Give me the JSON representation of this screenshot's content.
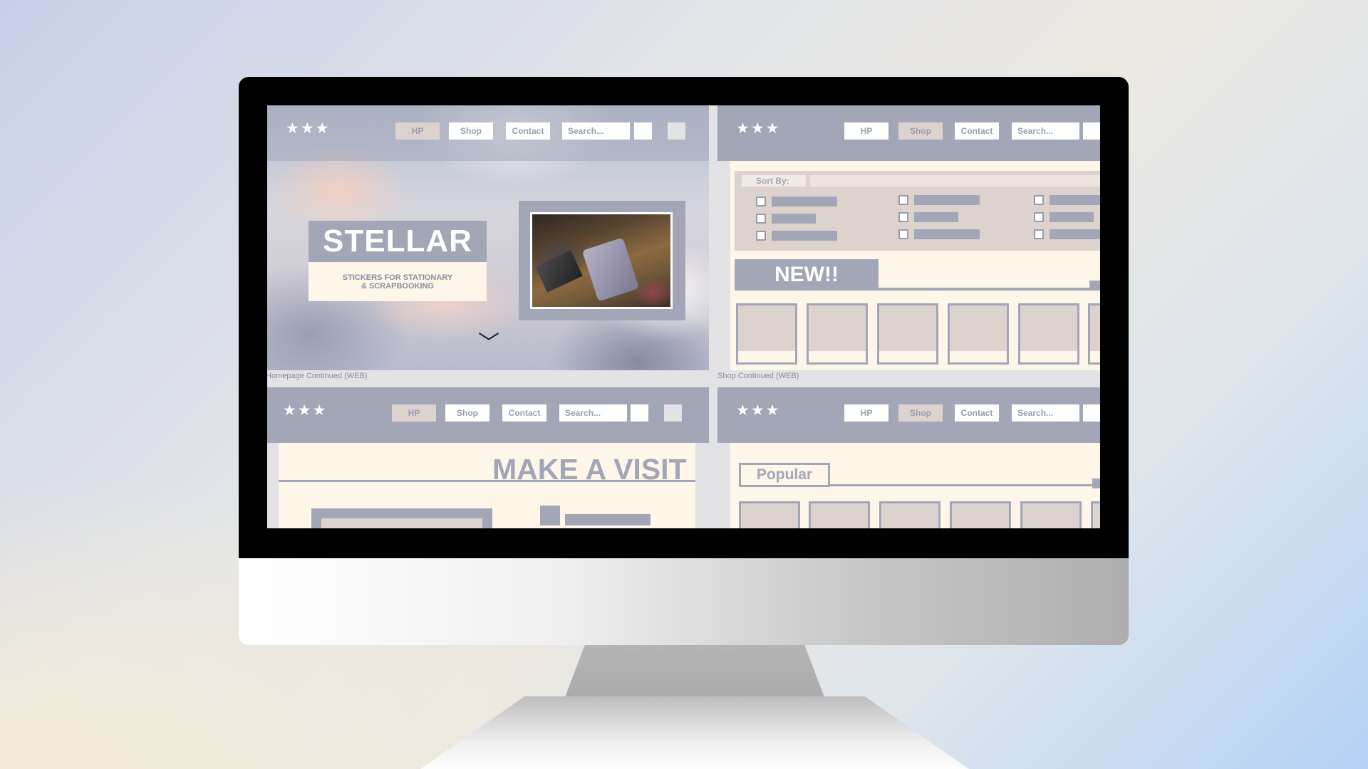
{
  "colors": {
    "nav": "#a2a6b7",
    "cream": "#fdf6e9",
    "beige": "#dcd3cf",
    "bezel": "#000000"
  },
  "logo_icon": "three-stars-icon",
  "logo_stars": [
    "★",
    "★",
    "★"
  ],
  "nav": {
    "hp": "HP",
    "shop": "Shop",
    "contact": "Contact",
    "search_placeholder": "Search..."
  },
  "homepage": {
    "title": "STELLAR",
    "subtitle_line1": "STICKERS FOR STATIONARY",
    "subtitle_line2": "& SCRAPBOOKING",
    "scroll_icon": "chevron-down-icon",
    "scroll_glyph": "﹀"
  },
  "shop": {
    "sort_label": "Sort By:",
    "new_heading": "NEW!!"
  },
  "captions": {
    "homepage": "Homepage Continued (WEB)",
    "shop": "Shop Continued (WEB)"
  },
  "visit": {
    "heading": "MAKE A VISIT"
  },
  "shop2": {
    "popular_heading": "Popular"
  }
}
